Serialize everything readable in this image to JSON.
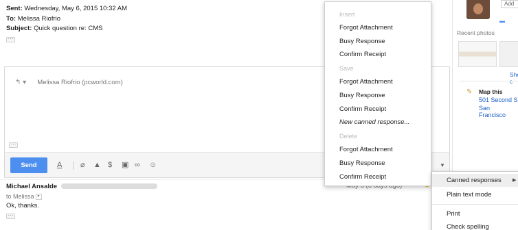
{
  "quoted_header": {
    "sent_label": "Sent:",
    "sent_value": "Wednesday, May 6, 2015 10:32 AM",
    "to_label": "To:",
    "to_value": "Melissa Riofrio",
    "subject_label": "Subject:",
    "subject_value": "Quick question re: CMS",
    "ellipsis": "···"
  },
  "reply": {
    "recipient": "Melissa Riofrio (pcworld.com)",
    "ellipsis": "···",
    "send_label": "Send"
  },
  "previous_message": {
    "sender": "Michael Ansalde",
    "to": "to Melissa",
    "body": "Ok, thanks.",
    "date": "May 6 (6 days ago)",
    "ellipsis": "···"
  },
  "sidebar": {
    "add_label": "Add",
    "recent_photos": "Recent photos",
    "show_more": "Show c",
    "map_title": "Map this",
    "address_line1": "501 Second S",
    "address_line2": "San Francisco"
  },
  "canned_menu": {
    "insert_header": "Insert",
    "insert_items": [
      "Forgot Attachment",
      "Busy Response",
      "Confirm Receipt"
    ],
    "save_header": "Save",
    "save_items": [
      "Forgot Attachment",
      "Busy Response",
      "Confirm Receipt"
    ],
    "new_canned": "New canned response...",
    "delete_header": "Delete",
    "delete_items": [
      "Forgot Attachment",
      "Busy Response",
      "Confirm Receipt"
    ]
  },
  "options_menu": {
    "canned_responses": "Canned responses",
    "plain_text_mode": "Plain text mode",
    "print": "Print",
    "check_spelling": "Check spelling"
  },
  "icons": {
    "reply": "reply-arrow-icon",
    "format_text": "format-text-icon",
    "attach": "paperclip-icon",
    "drive": "drive-icon",
    "money": "dollar-icon",
    "photo": "photo-icon",
    "link": "link-icon",
    "emoji": "emoji-icon",
    "star": "star-icon",
    "more": "more-options-icon"
  }
}
